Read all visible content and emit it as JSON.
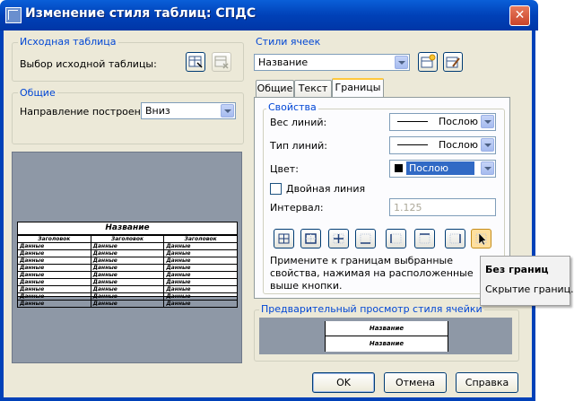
{
  "window": {
    "title": "Изменение стиля таблиц: СПДС",
    "close": "✕"
  },
  "source_table": {
    "legend": "Исходная таблица",
    "label": "Выбор исходной таблицы:"
  },
  "general": {
    "legend": "Общие",
    "direction_label": "Направление построения:",
    "direction_value": "Вниз"
  },
  "preview_table": {
    "title": "Название",
    "headers": [
      "Заголовок",
      "Заголовок",
      "Заголовок"
    ],
    "row_text": "Данные",
    "row_count": 9
  },
  "cell_styles": {
    "legend": "Стили ячеек",
    "selected": "Название"
  },
  "tabs": [
    {
      "label": "Общие"
    },
    {
      "label": "Текст"
    },
    {
      "label": "Границы"
    }
  ],
  "properties": {
    "legend": "Свойства",
    "line_weight_label": "Вес линий:",
    "line_weight_value": "Послою",
    "line_type_label": "Тип линий:",
    "line_type_value": "Послою",
    "color_label": "Цвет:",
    "color_value": "Послою",
    "double_line_label": "Двойная линия",
    "interval_label": "Интервал:",
    "interval_value": "1.125",
    "hint": "Примените к границам выбранные свойства, нажимая на расположенные выше кнопки."
  },
  "cell_preview": {
    "legend": "Предварительный просмотр стиля ячейки",
    "rows": [
      "Название",
      "Название"
    ]
  },
  "tooltip": {
    "title": "Без границ",
    "text": "Скрытие границ."
  },
  "buttons": {
    "ok": "OK",
    "cancel": "Отмена",
    "help": "Справка"
  },
  "colors": {
    "titlebar": "#0041b8",
    "dialog_bg": "#ece9d8",
    "group_text": "#0046d5",
    "selection": "#316ac5",
    "preview_bg": "#8e98a6"
  }
}
